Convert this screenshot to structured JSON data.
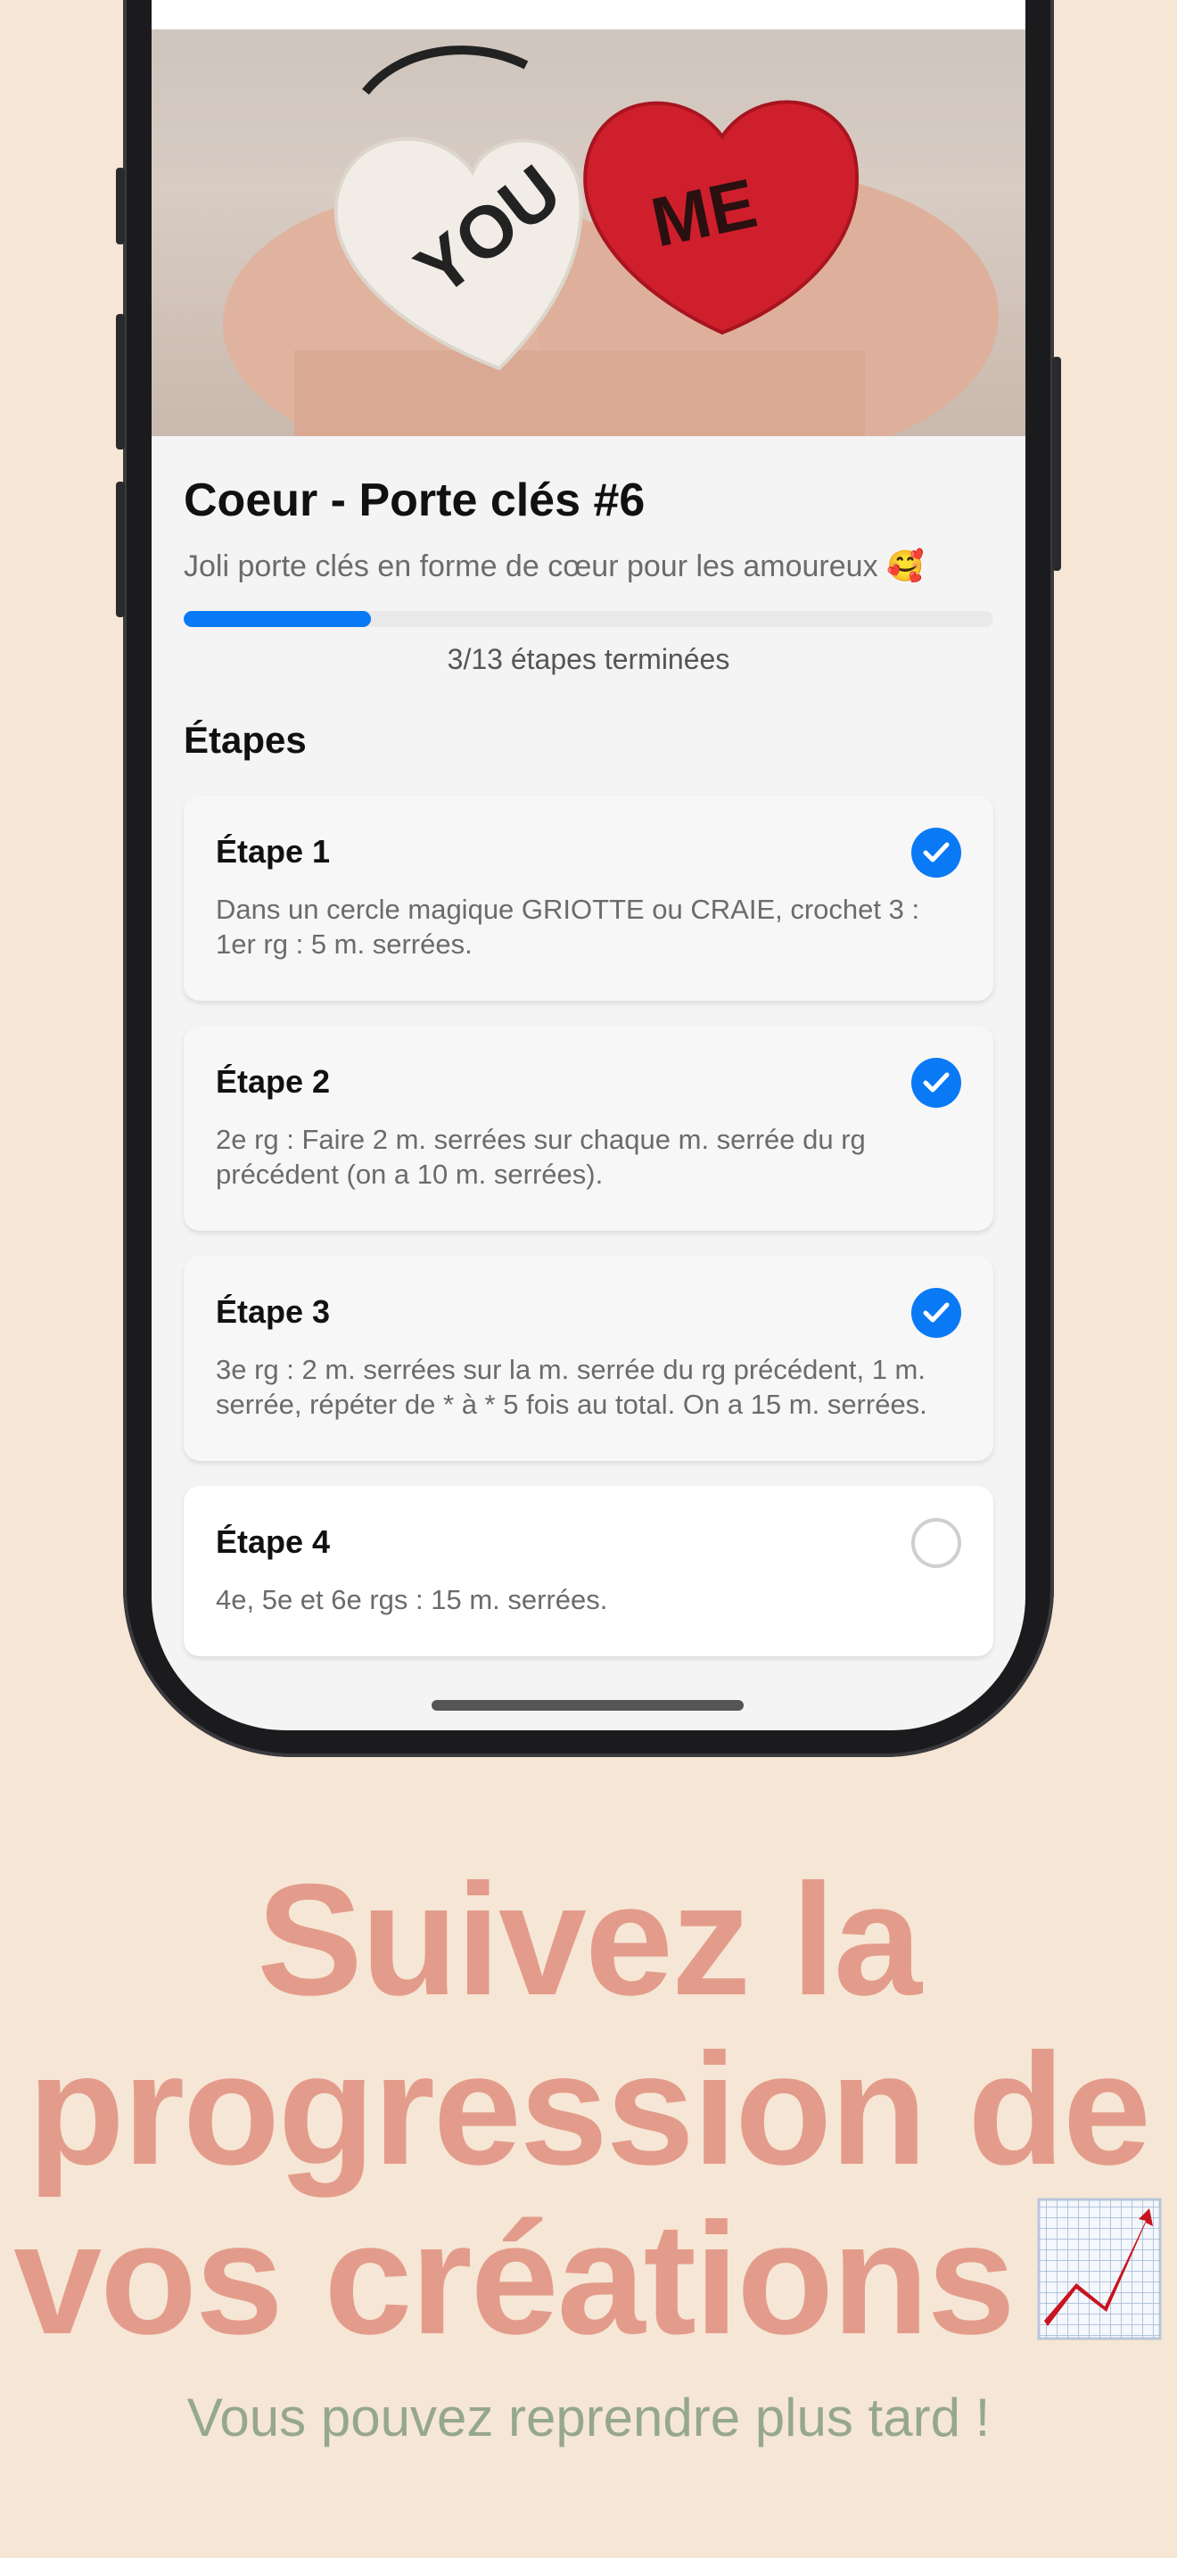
{
  "project": {
    "title": "Coeur - Porte clés #6",
    "description": "Joli porte clés en forme de cœur pour les amoureux 🥰",
    "progress": {
      "completed": 3,
      "total": 13,
      "fraction": 0.2308
    },
    "progress_label": "3/13 étapes terminées"
  },
  "hero_image": {
    "text_left_heart": "YOU",
    "text_right_heart": "ME"
  },
  "steps_section_title": "Étapes",
  "steps": [
    {
      "title": "Étape 1",
      "description": "Dans un cercle magique GRIOTTE ou CRAIE, crochet 3 : 1er rg : 5 m. serrées.",
      "done": true
    },
    {
      "title": "Étape 2",
      "description": "2e rg : Faire 2 m. serrées sur chaque m. serrée du rg précédent (on a 10 m. serrées).",
      "done": true
    },
    {
      "title": "Étape 3",
      "description": "3e rg : 2 m. serrées sur la m. serrée du rg précédent, 1 m. serrée, répéter de * à * 5 fois au total. On a 15 m. serrées.",
      "done": true
    },
    {
      "title": "Étape 4",
      "description": "4e, 5e et 6e rgs : 15 m. serrées.",
      "done": false
    }
  ],
  "marketing": {
    "headline_line1": "Suivez la",
    "headline_line2": "progression de",
    "headline_line3": "vos créations",
    "headline_icon": "chart-increasing-icon",
    "tagline": "Vous pouvez reprendre plus tard !"
  },
  "colors": {
    "background": "#f6e6d5",
    "accent_blue": "#0a79f6",
    "headline": "#e39c8b",
    "tagline": "#96a88b"
  }
}
